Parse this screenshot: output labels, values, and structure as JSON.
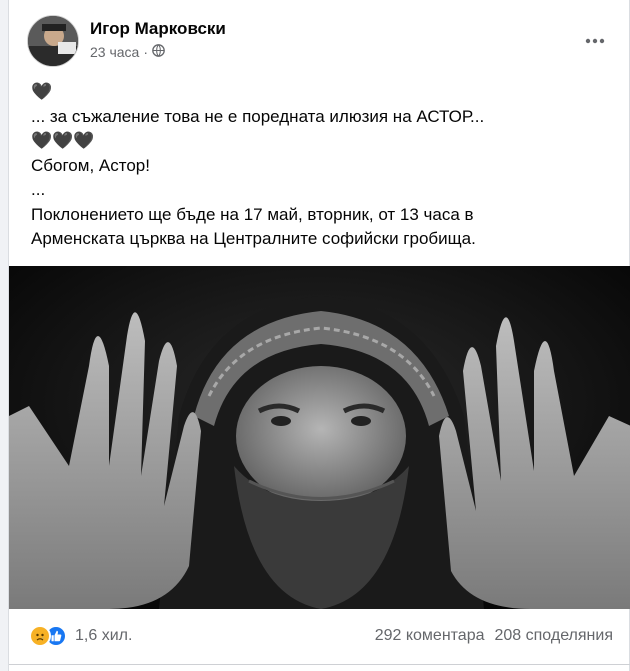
{
  "post": {
    "author": "Игор Марковски",
    "time": "23 часа",
    "separator": "·",
    "privacy_icon": "globe-icon",
    "menu_icon": "more-dots-icon",
    "lines": [
      "🖤",
      "... за съжаление това не е поредната илюзия на АСТОР...",
      "🖤🖤🖤",
      "Сбогом, Астор!",
      "...",
      "Поклонението ще бъде на 17 май, вторник, от 13 часа в",
      "Арменската църква на Централните софийски гробища."
    ]
  },
  "footer": {
    "reaction_icons": [
      "sad-reaction-icon",
      "like-reaction-icon"
    ],
    "reaction_count": "1,6 хил.",
    "comments": "292 коментара",
    "shares": "208 споделяния"
  },
  "colors": {
    "like_blue": "#1877f2",
    "sad_yellow": "#f7b125",
    "secondary_text": "#65676b"
  }
}
